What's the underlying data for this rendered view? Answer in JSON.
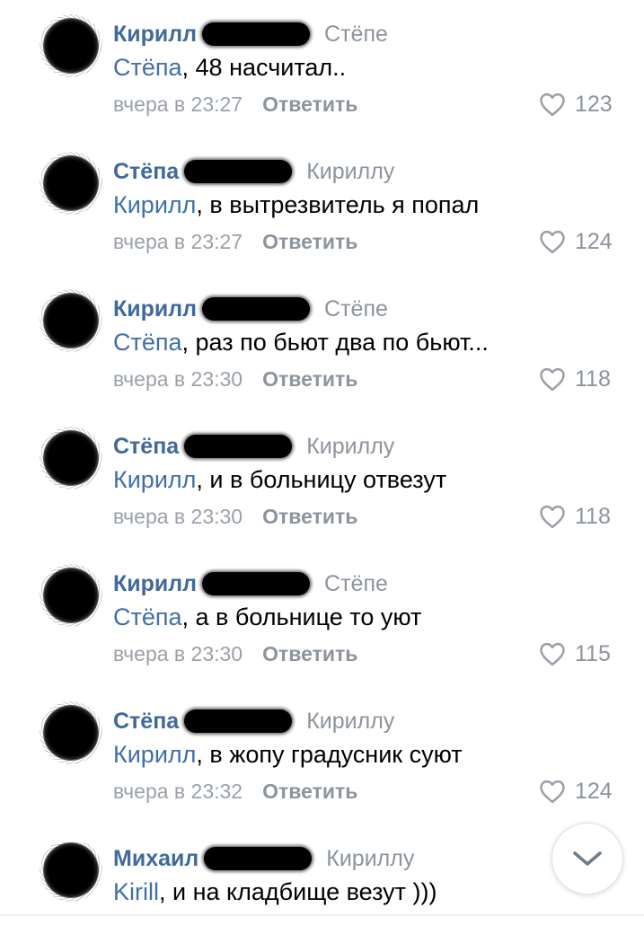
{
  "comments": [
    {
      "author": "Кирилл",
      "reply_to": "Стёпе",
      "mention": "Стёпа",
      "text": ", 48 насчитал..",
      "time": "вчера в 23:27",
      "reply_label": "Ответить",
      "likes": "123"
    },
    {
      "author": "Стёпа",
      "reply_to": "Кириллу",
      "mention": "Кирилл",
      "text": ", в вытрезвитель я попал",
      "time": "вчера в 23:27",
      "reply_label": "Ответить",
      "likes": "124"
    },
    {
      "author": "Кирилл",
      "reply_to": "Стёпе",
      "mention": "Стёпа",
      "text": ", раз по бьют два по бьют...",
      "time": "вчера в 23:30",
      "reply_label": "Ответить",
      "likes": "118"
    },
    {
      "author": "Стёпа",
      "reply_to": "Кириллу",
      "mention": "Кирилл",
      "text": ", и в больницу отвезут",
      "time": "вчера в 23:30",
      "reply_label": "Ответить",
      "likes": "118"
    },
    {
      "author": "Кирилл",
      "reply_to": "Стёпе",
      "mention": "Стёпа",
      "text": ", а в больнице то уют",
      "time": "вчера в 23:30",
      "reply_label": "Ответить",
      "likes": "115"
    },
    {
      "author": "Стёпа",
      "reply_to": "Кириллу",
      "mention": "Кирилл",
      "text": ", в жопу градусник суют",
      "time": "вчера в 23:32",
      "reply_label": "Ответить",
      "likes": "124"
    },
    {
      "author": "Михаил",
      "reply_to": "Кириллу",
      "mention": "Kirill",
      "text": ", и на кладбище везут )))"
    }
  ],
  "icons": {
    "like": "heart-outline-icon",
    "scroll_down": "chevron-down-icon"
  },
  "colors": {
    "author": "#3f6a9b",
    "mention": "#3f6fab",
    "muted": "#8d949c"
  }
}
